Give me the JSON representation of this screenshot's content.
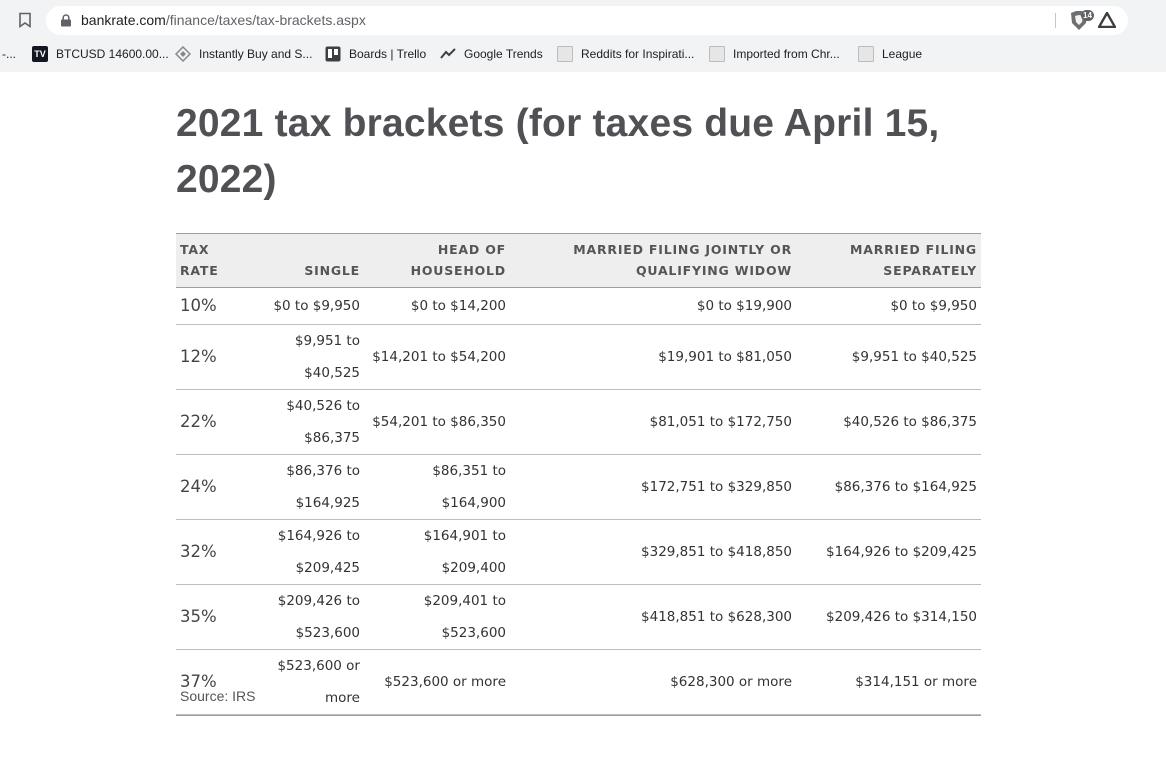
{
  "browser": {
    "url_host": "bankrate.com",
    "url_path": "/finance/taxes/tax-brackets.aspx",
    "extension_badge": "14",
    "bookmarks": [
      {
        "label": "-...",
        "icon": "dash"
      },
      {
        "label": "BTCUSD 14600.00...",
        "icon": "tradingview-icon"
      },
      {
        "label": "Instantly Buy and S...",
        "icon": "diamond-icon"
      },
      {
        "label": "Boards | Trello",
        "icon": "trello-icon"
      },
      {
        "label": "Google Trends",
        "icon": "trends-icon"
      },
      {
        "label": "Reddits for Inspirati...",
        "icon": "doc-icon"
      },
      {
        "label": "Imported from Chr...",
        "icon": "doc-icon"
      },
      {
        "label": "League",
        "icon": "doc-icon"
      }
    ]
  },
  "page": {
    "title": "2021 tax brackets (for taxes due April 15, 2022)",
    "source": "Source: IRS"
  },
  "table": {
    "headers": {
      "rate": "Tax rate",
      "single": "Single",
      "hoh": "Head of household",
      "mfj": "Married filing jointly or qualifying widow",
      "mfs": "Married filing separately"
    },
    "rows": [
      {
        "rate": "10%",
        "single": "$0 to $9,950",
        "hoh": "$0 to $14,200",
        "mfj": "$0 to $19,900",
        "mfs": "$0 to $9,950"
      },
      {
        "rate": "12%",
        "single": "$9,951 to $40,525",
        "hoh": "$14,201 to $54,200",
        "mfj": "$19,901 to $81,050",
        "mfs": "$9,951 to $40,525"
      },
      {
        "rate": "22%",
        "single": "$40,526 to $86,375",
        "hoh": "$54,201 to $86,350",
        "mfj": "$81,051 to $172,750",
        "mfs": "$40,526 to $86,375"
      },
      {
        "rate": "24%",
        "single": "$86,376 to $164,925",
        "hoh": "$86,351 to $164,900",
        "mfj": "$172,751 to $329,850",
        "mfs": "$86,376 to $164,925"
      },
      {
        "rate": "32%",
        "single": "$164,926 to $209,425",
        "hoh": "$164,901 to $209,400",
        "mfj": "$329,851 to $418,850",
        "mfs": "$164,926 to $209,425"
      },
      {
        "rate": "35%",
        "single": "$209,426 to $523,600",
        "hoh": "$209,401 to $523,600",
        "mfj": "$418,851  to $628,300",
        "mfs": "$209,426 to $314,150"
      },
      {
        "rate": "37%",
        "single": "$523,600 or more",
        "hoh": "$523,600 or more",
        "mfj": "$628,300 or more",
        "mfs": "$314,151 or more"
      }
    ]
  }
}
